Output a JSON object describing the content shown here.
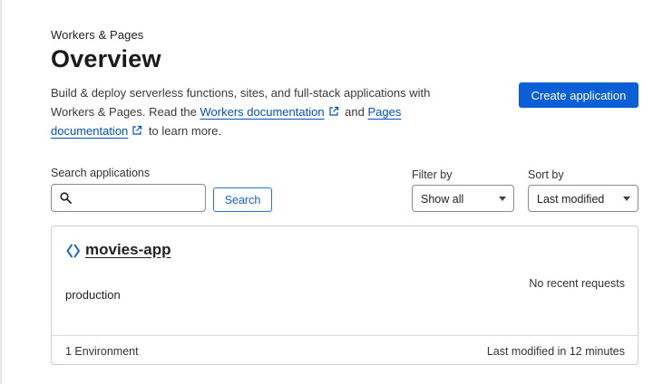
{
  "header": {
    "breadcrumb": "Workers & Pages",
    "title": "Overview",
    "description": {
      "part1": "Build & deploy serverless functions, sites, and full-stack applications with Workers & Pages. Read the ",
      "workers_link": "Workers documentation",
      "part2": " and ",
      "pages_link": "Pages documentation",
      "part3": " to learn more."
    },
    "create_button": "Create application"
  },
  "search": {
    "label": "Search applications",
    "value": "",
    "button": "Search"
  },
  "filter": {
    "label": "Filter by",
    "selected": "Show all"
  },
  "sort": {
    "label": "Sort by",
    "selected": "Last modified"
  },
  "apps": [
    {
      "name": "movies-app",
      "branch": "production",
      "requests": "No recent requests",
      "environments": "1 Environment",
      "modified": "Last modified in 12 minutes"
    }
  ],
  "colors": {
    "accent": "#0a5fd6",
    "link": "#0051c3"
  }
}
